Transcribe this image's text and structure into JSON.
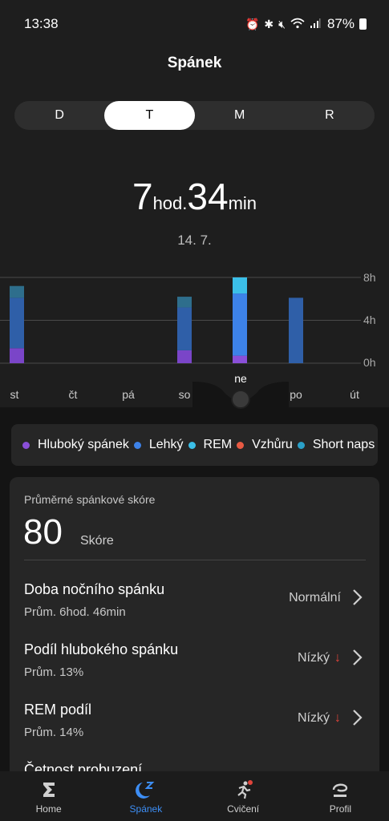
{
  "status_bar": {
    "time": "13:38",
    "battery": "87%",
    "icons": [
      "alarm-icon",
      "bluetooth-icon",
      "mute-icon",
      "wifi-icon",
      "signal-icon",
      "battery-icon"
    ]
  },
  "header": {
    "title": "Spánek"
  },
  "period_tabs": [
    {
      "label": "D",
      "active": false
    },
    {
      "label": "T",
      "active": true
    },
    {
      "label": "M",
      "active": false
    },
    {
      "label": "R",
      "active": false
    }
  ],
  "summary": {
    "hours": "7",
    "hours_unit": "hod.",
    "minutes": "34",
    "minutes_unit": "min",
    "date": "14. 7."
  },
  "chart_data": {
    "type": "bar",
    "stacked": true,
    "categories": [
      "st",
      "čt",
      "pá",
      "so",
      "ne",
      "po",
      "út"
    ],
    "selected_category": "ne",
    "y_ticks": [
      "8h",
      "4h",
      "0h"
    ],
    "ylim": [
      0,
      8
    ],
    "series": [
      {
        "key": "deep",
        "values": [
          1.4,
          0,
          0,
          1.2,
          0.7,
          0,
          0
        ]
      },
      {
        "key": "light",
        "values": [
          4.7,
          0,
          0,
          4.0,
          5.8,
          6.1,
          0
        ]
      },
      {
        "key": "rem",
        "values": [
          1.1,
          0,
          0,
          1.0,
          1.5,
          0,
          0
        ]
      }
    ],
    "grid": true
  },
  "legend": [
    {
      "label": "Hluboký spánek",
      "color": "#8a4fd8"
    },
    {
      "label": "Lehký",
      "color": "#3d82e8"
    },
    {
      "label": "REM",
      "color": "#3bbfe8"
    },
    {
      "label": "Vzhůru",
      "color": "#e85a43"
    },
    {
      "label": "Short naps",
      "color": "#2aa0c8"
    }
  ],
  "score_card": {
    "caption": "Průměrné spánkové skóre",
    "score": "80",
    "score_label": "Skóre"
  },
  "metrics": [
    {
      "title": "Doba nočního spánku",
      "subtitle": "Prům. 6hod. 46min",
      "status": "Normální",
      "trend": ""
    },
    {
      "title": "Podíl hlubokého spánku",
      "subtitle": "Prům. 13%",
      "status": "Nízký",
      "trend": "↓"
    },
    {
      "title": "REM podíl",
      "subtitle": "Prům. 14%",
      "status": "Nízký",
      "trend": "↓"
    },
    {
      "title": "Četnost probuzení",
      "subtitle": "",
      "status": "",
      "trend": ""
    }
  ],
  "bottom_nav": [
    {
      "label": "Home",
      "icon": "sigma-icon",
      "active": false
    },
    {
      "label": "Spánek",
      "icon": "moon-icon",
      "active": true
    },
    {
      "label": "Cvičení",
      "icon": "runner-icon",
      "active": false
    },
    {
      "label": "Profil",
      "icon": "profile-icon",
      "active": false
    }
  ]
}
